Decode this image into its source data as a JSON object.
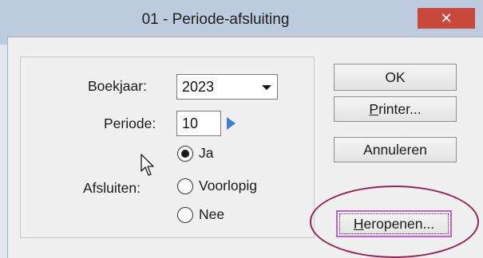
{
  "window": {
    "title": "01 - Periode-afsluiting",
    "close_symbol": "✕"
  },
  "form": {
    "boekjaar_label": "Boekjaar:",
    "boekjaar_value": "2023",
    "periode_label": "Periode:",
    "periode_value": "10",
    "afsluiten_label": "Afsluiten:",
    "options": [
      {
        "label": "Ja",
        "selected": true
      },
      {
        "label": "Voorlopig",
        "selected": false
      },
      {
        "label": "Nee",
        "selected": false
      }
    ]
  },
  "buttons": {
    "ok": "OK",
    "printer_underlined": "P",
    "printer_rest": "rinter...",
    "annuleren": "Annuleren",
    "heropenen_underlined": "H",
    "heropenen_rest": "eropenen..."
  },
  "colors": {
    "titlebar": "#bcccde",
    "close": "#c9483c",
    "highlight_ellipse": "#9b2257",
    "focus_border": "#c65fd6",
    "next_arrow": "#3d7fd6"
  },
  "icons": [
    "close-icon",
    "dropdown-arrow-icon",
    "next-period-arrow-icon",
    "mouse-cursor-icon"
  ]
}
